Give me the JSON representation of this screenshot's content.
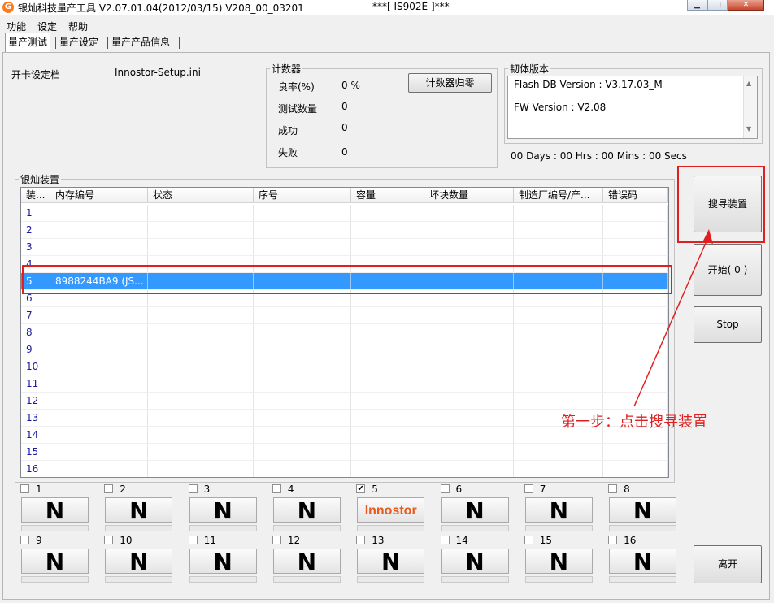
{
  "window": {
    "title": "银灿科技量产工具 V2.07.01.04(2012/03/15)    V208_00_03201",
    "center_title": "***[ IS902E ]***",
    "icon_glyph": "G"
  },
  "menu": [
    "功能",
    "设定",
    "帮助"
  ],
  "tabs": [
    "量产测试",
    "量产设定",
    "量产产品信息"
  ],
  "setting_file": {
    "label": "开卡设定档",
    "value": "Innostor-Setup.ini"
  },
  "counter": {
    "title": "计数器",
    "rows": [
      {
        "label": "良率(%)",
        "value": "0 %"
      },
      {
        "label": "测试数量",
        "value": "0"
      },
      {
        "label": "成功",
        "value": "0"
      },
      {
        "label": "失败",
        "value": "0"
      }
    ],
    "reset_button": "计数器归零"
  },
  "firmware": {
    "title": "韧体版本",
    "lines": [
      "Flash DB Version :  V3.17.03_M",
      "FW Version :   V2.08"
    ],
    "timer": "00 Days : 00 Hrs : 00 Mins : 00 Secs"
  },
  "devices": {
    "title": "银灿装置",
    "columns": [
      "装...",
      "内存编号",
      "状态",
      "序号",
      "容量",
      "坏块数量",
      "制造厂编号/产...",
      "错误码"
    ],
    "rows": [
      [
        "1",
        "",
        "",
        "",
        "",
        "",
        "",
        ""
      ],
      [
        "2",
        "",
        "",
        "",
        "",
        "",
        "",
        ""
      ],
      [
        "3",
        "",
        "",
        "",
        "",
        "",
        "",
        ""
      ],
      [
        "4",
        "",
        "",
        "",
        "",
        "",
        "",
        ""
      ],
      [
        "5",
        "8988244BA9 (JS...",
        "",
        "",
        "",
        "",
        "",
        ""
      ],
      [
        "6",
        "",
        "",
        "",
        "",
        "",
        "",
        ""
      ],
      [
        "7",
        "",
        "",
        "",
        "",
        "",
        "",
        ""
      ],
      [
        "8",
        "",
        "",
        "",
        "",
        "",
        "",
        ""
      ],
      [
        "9",
        "",
        "",
        "",
        "",
        "",
        "",
        ""
      ],
      [
        "10",
        "",
        "",
        "",
        "",
        "",
        "",
        ""
      ],
      [
        "11",
        "",
        "",
        "",
        "",
        "",
        "",
        ""
      ],
      [
        "12",
        "",
        "",
        "",
        "",
        "",
        "",
        ""
      ],
      [
        "13",
        "",
        "",
        "",
        "",
        "",
        "",
        ""
      ],
      [
        "14",
        "",
        "",
        "",
        "",
        "",
        "",
        ""
      ],
      [
        "15",
        "",
        "",
        "",
        "",
        "",
        "",
        ""
      ],
      [
        "16",
        "",
        "",
        "",
        "",
        "",
        "",
        ""
      ]
    ],
    "selected_row": 5
  },
  "slots": [
    {
      "label": "1",
      "checked": false,
      "badge": "N"
    },
    {
      "label": "2",
      "checked": false,
      "badge": "N"
    },
    {
      "label": "3",
      "checked": false,
      "badge": "N"
    },
    {
      "label": "4",
      "checked": false,
      "badge": "N"
    },
    {
      "label": "5",
      "checked": true,
      "badge": "Innostor"
    },
    {
      "label": "6",
      "checked": false,
      "badge": "N"
    },
    {
      "label": "7",
      "checked": false,
      "badge": "N"
    },
    {
      "label": "8",
      "checked": false,
      "badge": "N"
    },
    {
      "label": "9",
      "checked": false,
      "badge": "N"
    },
    {
      "label": "10",
      "checked": false,
      "badge": "N"
    },
    {
      "label": "11",
      "checked": false,
      "badge": "N"
    },
    {
      "label": "12",
      "checked": false,
      "badge": "N"
    },
    {
      "label": "13",
      "checked": false,
      "badge": "N"
    },
    {
      "label": "14",
      "checked": false,
      "badge": "N"
    },
    {
      "label": "15",
      "checked": false,
      "badge": "N"
    },
    {
      "label": "16",
      "checked": false,
      "badge": "N"
    }
  ],
  "buttons": {
    "search": "搜寻装置",
    "start": "开始( 0 )",
    "stop": "Stop",
    "exit": "离开"
  },
  "annotation": "第一步：点击搜寻装置",
  "colors": {
    "highlight": "#e02020",
    "selection": "#3399ff",
    "brand": "#e8591a"
  }
}
